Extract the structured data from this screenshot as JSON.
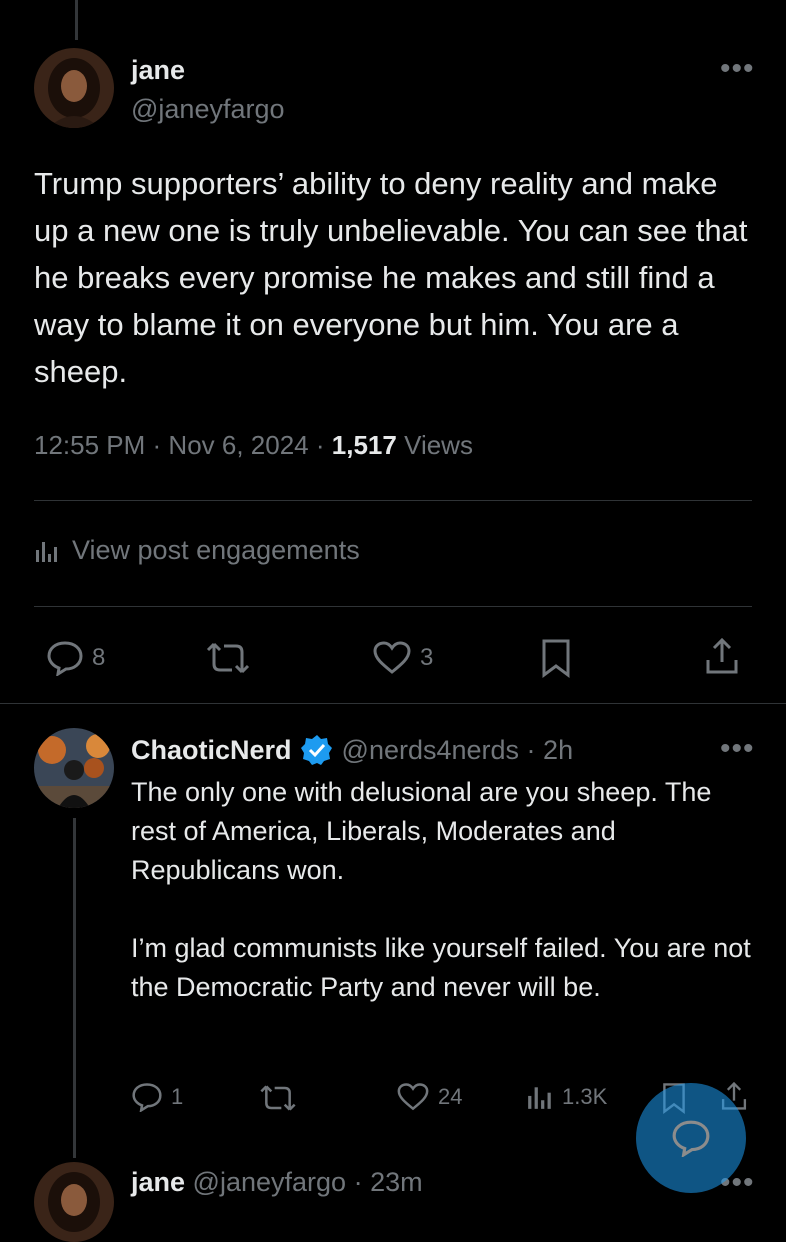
{
  "main_post": {
    "display_name": "jane",
    "handle": "@janeyfargo",
    "text": "Trump supporters’ ability to deny reality and make up a new one is truly unbelievable. You can see that he breaks every promise he makes and still find a way to blame it on everyone but him. You are a sheep.",
    "time": "12:55 PM",
    "date": "Nov 6, 2024",
    "views_count": "1,517",
    "views_label": "Views",
    "engagements_label": "View post engagements",
    "stats": {
      "replies": "8",
      "likes": "3"
    }
  },
  "reply": {
    "display_name": "ChaoticNerd",
    "handle": "@nerds4nerds",
    "time": "2h",
    "text": "The only one with delusional are you sheep. The rest of America, Liberals, Moderates and Republicans won.\n\nI’m glad communists like yourself failed. You are not the Democratic Party and never will be.",
    "stats": {
      "replies": "1",
      "likes": "24",
      "views": "1.3K"
    }
  },
  "next_reply": {
    "display_name": "jane",
    "handle": "@janeyfargo",
    "time": "23m"
  },
  "colors": {
    "background": "#000000",
    "text": "#e7e9ea",
    "muted": "#71767b",
    "accent": "#1d9bf0",
    "divider": "#2f3336"
  }
}
